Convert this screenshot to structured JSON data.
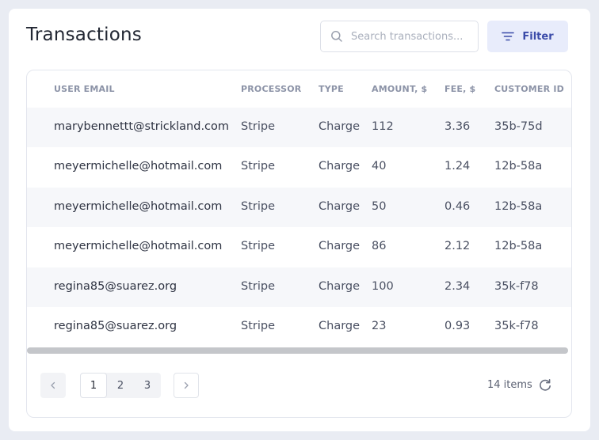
{
  "header": {
    "title": "Transactions",
    "search_placeholder": "Search transactions...",
    "filter_label": "Filter"
  },
  "table": {
    "columns": [
      "USER EMAIL",
      "PROCESSOR",
      "TYPE",
      "AMOUNT, $",
      "FEE, $",
      "CUSTOMER ID"
    ],
    "rows": [
      [
        "marybennettt@strickland.com",
        "Stripe",
        "Charge",
        "112",
        "3.36",
        "35b-75d"
      ],
      [
        "meyermichelle@hotmail.com",
        "Stripe",
        "Charge",
        "40",
        "1.24",
        "12b-58a"
      ],
      [
        "meyermichelle@hotmail.com",
        "Stripe",
        "Charge",
        "50",
        "0.46",
        "12b-58a"
      ],
      [
        "meyermichelle@hotmail.com",
        "Stripe",
        "Charge",
        "86",
        "2.12",
        "12b-58a"
      ],
      [
        "regina85@suarez.org",
        "Stripe",
        "Charge",
        "100",
        "2.34",
        "35k-f78"
      ],
      [
        "regina85@suarez.org",
        "Stripe",
        "Charge",
        "23",
        "0.93",
        "35k-f78"
      ]
    ]
  },
  "pagination": {
    "prev_icon": "chevron-left-icon",
    "next_icon": "chevron-right-icon",
    "pages": [
      "1",
      "2",
      "3"
    ],
    "current_page": "1",
    "items_count": "14 items",
    "refresh_icon": "refresh-icon"
  },
  "colors": {
    "background": "#e9ecf3",
    "accent": "#3a4aa8",
    "filter_bg": "#e8ecfb"
  }
}
